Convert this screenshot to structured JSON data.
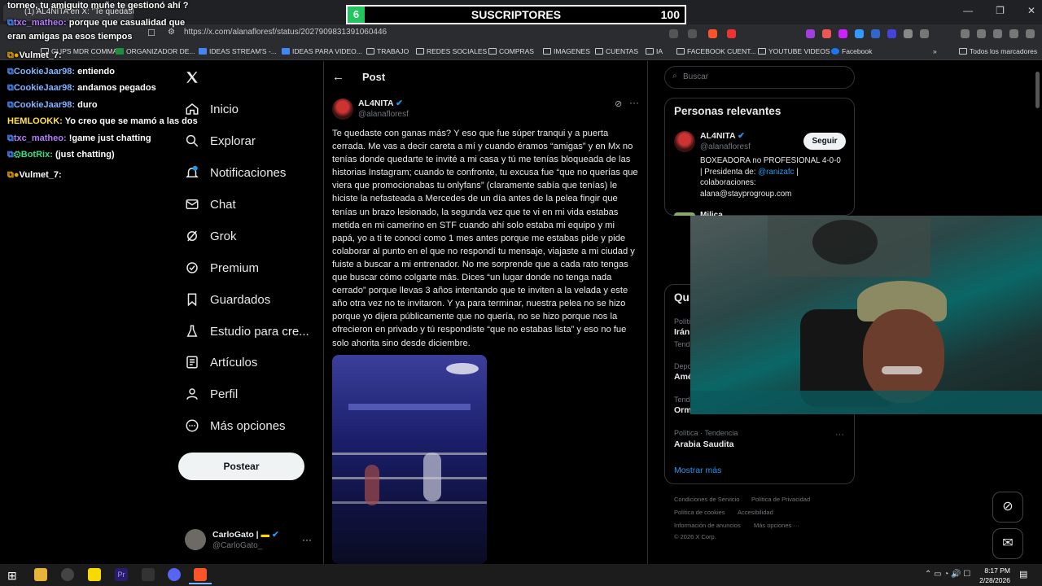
{
  "browser": {
    "tab_title": "(1) AL4NITA en X: \"Te quedaste",
    "url": "https://x.com/alanafloresf/status/2027909831391060446",
    "bookmarks": [
      "CLIPS MDR COMMA...",
      "ORGANIZADOR DE...",
      "IDEAS STREAM'S -...",
      "IDEAS PARA VIDEO...",
      "TRABAJO",
      "REDES SOCIALES",
      "COMPRAS",
      "IMAGENES",
      "CUENTAS",
      "IA",
      "FACEBOOK CUENT...",
      "YOUTUBE VIDEOS",
      "Facebook",
      "Todos los marcadores"
    ],
    "notif_badge": "1"
  },
  "stream": {
    "subs_count_left": "6",
    "subs_label": "SUSCRIPTORES",
    "subs_goal": "100",
    "chat_top": "torneo, tu amiguito muñe te gestionó ahí ?",
    "chat": [
      {
        "user": "txc_matheo:",
        "msg": "porque que casualidad que",
        "color": "#b77cff"
      },
      {
        "user": "",
        "msg": "eran amigas pa esos tiempos",
        "color": "#fff"
      },
      {
        "user": "Vulmet_7:",
        "msg": "",
        "color": "#fff"
      },
      {
        "user": "CookieJaar98:",
        "msg": "entiendo",
        "color": "#7fb2ff"
      },
      {
        "user": "CookieJaar98:",
        "msg": "andamos pegados",
        "color": "#7fb2ff"
      },
      {
        "user": "CookieJaar98:",
        "msg": "duro",
        "color": "#7fb2ff"
      },
      {
        "user": "HEMLOOKK:",
        "msg": "Yo creo que se mamó a las dos",
        "color": "#ffe14d"
      },
      {
        "user": "txc_matheo:",
        "msg": "!game just chatting",
        "color": "#b77cff"
      },
      {
        "user": "BotRix:",
        "msg": "(just chatting)",
        "color": "#3ddc84"
      },
      {
        "user": "Vulmet_7:",
        "msg": "",
        "color": "#fff"
      }
    ]
  },
  "sidebar": {
    "items": [
      {
        "label": "Inicio",
        "icon": "home-icon"
      },
      {
        "label": "Explorar",
        "icon": "search-icon"
      },
      {
        "label": "Notificaciones",
        "icon": "bell-icon",
        "badge": "1"
      },
      {
        "label": "Chat",
        "icon": "mail-icon"
      },
      {
        "label": "Grok",
        "icon": "grok-icon"
      },
      {
        "label": "Premium",
        "icon": "verified-icon"
      },
      {
        "label": "Guardados",
        "icon": "bookmark-icon"
      },
      {
        "label": "Estudio para cre...",
        "icon": "flask-icon"
      },
      {
        "label": "Artículos",
        "icon": "article-icon"
      },
      {
        "label": "Perfil",
        "icon": "person-icon"
      },
      {
        "label": "Más opciones",
        "icon": "more-circle-icon"
      }
    ],
    "post_button": "Postear",
    "account": {
      "name": "CarloGato |",
      "handle": "@CarloGato_"
    }
  },
  "post": {
    "header": "Post",
    "author_name": "AL4NITA",
    "author_handle": "@alanafloresf",
    "text": "Te quedaste con ganas más? Y eso que fue súper tranqui y a puerta cerrada. Me vas a decir careta a mí y cuando éramos “amigas” y en Mx no tenías donde quedarte te invité a mi casa y tú me tenías bloqueada de las historias Instagram; cuando te confronte, tu excusa fue “que no querías que viera que promocionabas tu onlyfans” (claramente sabía que tenías) le hiciste la nefasteada a Mercedes de un día antes de la pelea fingir que tenías un brazo lesionado, la segunda vez que te vi en mi vida estabas metida en mi camerino en STF cuando ahí solo estaba mi equipo y mi papá, yo a ti te conocí como 1 mes antes porque me estabas pide y pide colaborar al punto en el que no respondí tu mensaje, viajaste a mi ciudad y fuiste a buscar a mi entrenador. No me sorprende que a cada rato tengas que buscar cómo colgarte más. Dices “un lugar donde no tenga nada cerrado” porque llevas 3 años intentando que te inviten a la velada y este año otra vez no te invitaron. Y ya para terminar, nuestra pelea no se hizo porque yo dijera públicamente que no quería, no se hizo porque nos la ofrecieron en privado y tú respondiste “que no estabas lista” y eso no fue solo ahorita sino desde diciembre."
  },
  "right": {
    "search_placeholder": "Buscar",
    "relevant_title": "Personas relevantes",
    "person1": {
      "name": "AL4NITA",
      "handle": "@alanafloresf",
      "follow": "Seguir",
      "bio_1": "BOXEADORA no PROFESIONAL 4-0-0",
      "bio_2": "| Presidenta de:",
      "bio_link": "@ranizafc",
      "bio_3": "|",
      "bio_4": "colaboraciones:",
      "bio_5": "alana@stayprogroup.com"
    },
    "person2_name": "Milica",
    "trends_title": "Qu",
    "trends": [
      {
        "cat": "Polític",
        "name": "Irán"
      },
      {
        "cat": "Tend",
        "name": ""
      },
      {
        "cat": "Depo",
        "name": "Amé"
      },
      {
        "cat": "Tend",
        "name": "Orm"
      }
    ],
    "trend_last_cat": "Política · Tendencia",
    "trend_last_name": "Arabia Saudita",
    "show_more": "Mostrar más",
    "footer": [
      "Condiciones de Servicio",
      "Política de Privacidad",
      "Política de cookies",
      "Accesibilidad",
      "Información de anuncios",
      "Más opciones ···",
      "© 2026 X Corp."
    ]
  },
  "taskbar": {
    "time": "8:17 PM",
    "date": "2/28/2026"
  }
}
